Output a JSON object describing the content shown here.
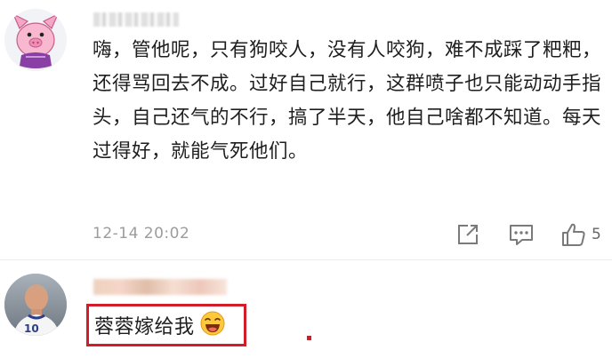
{
  "comments": [
    {
      "avatar": "pig-cartoon-avatar",
      "body": "嗨，管他呢，只有狗咬人，没有人咬狗，难不成踩了粑粑，还得骂回去不成。过好自己就行，这群喷子也只能动动手指头，自己还气的不行，搞了半天，他自己啥都不知道。每天过得好，就能气死他们。",
      "timestamp": "12-14 20:02",
      "actions": {
        "share_icon": "share-icon",
        "reply_icon": "comment-icon",
        "like_icon": "thumbs-up-icon",
        "like_count": "5"
      }
    },
    {
      "avatar": "soccer-player-avatar",
      "body": "蓉蓉嫁给我",
      "emoji": "laughing-emoji",
      "highlight_color": "#d21c2a"
    }
  ]
}
